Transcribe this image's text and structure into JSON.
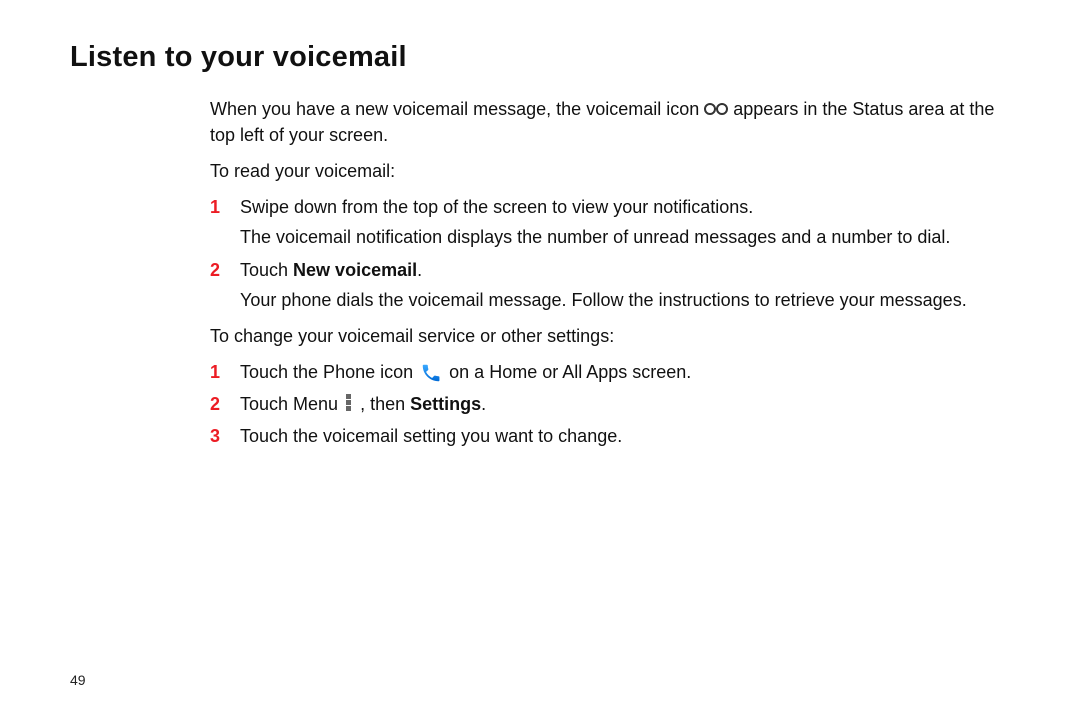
{
  "heading": "Listen to your voicemail",
  "intro_before_icon": "When you have a new voicemail message, the voicemail icon ",
  "intro_after_icon": " appears in the Status area at the top left of your screen.",
  "read_lead": "To read your voicemail:",
  "read_steps": [
    {
      "num": "1",
      "text": "Swipe down from the top of the screen to view your notifications.",
      "sub": "The voicemail notification displays the number of unread messages and a number to dial."
    },
    {
      "num": "2",
      "prefix": "Touch ",
      "bold": "New voicemail",
      "suffix": ".",
      "sub": "Your phone dials the voicemail message. Follow the instructions to retrieve your messages."
    }
  ],
  "change_lead": "To change your voicemail service or other settings:",
  "change_steps": {
    "s1": {
      "num": "1",
      "before": "Touch the Phone icon ",
      "after": " on a Home or All Apps screen."
    },
    "s2": {
      "num": "2",
      "before": "Touch Menu ",
      "mid": ", then ",
      "bold": "Settings",
      "suffix": "."
    },
    "s3": {
      "num": "3",
      "text": "Touch the voicemail setting you want to change."
    }
  },
  "page_number": "49"
}
